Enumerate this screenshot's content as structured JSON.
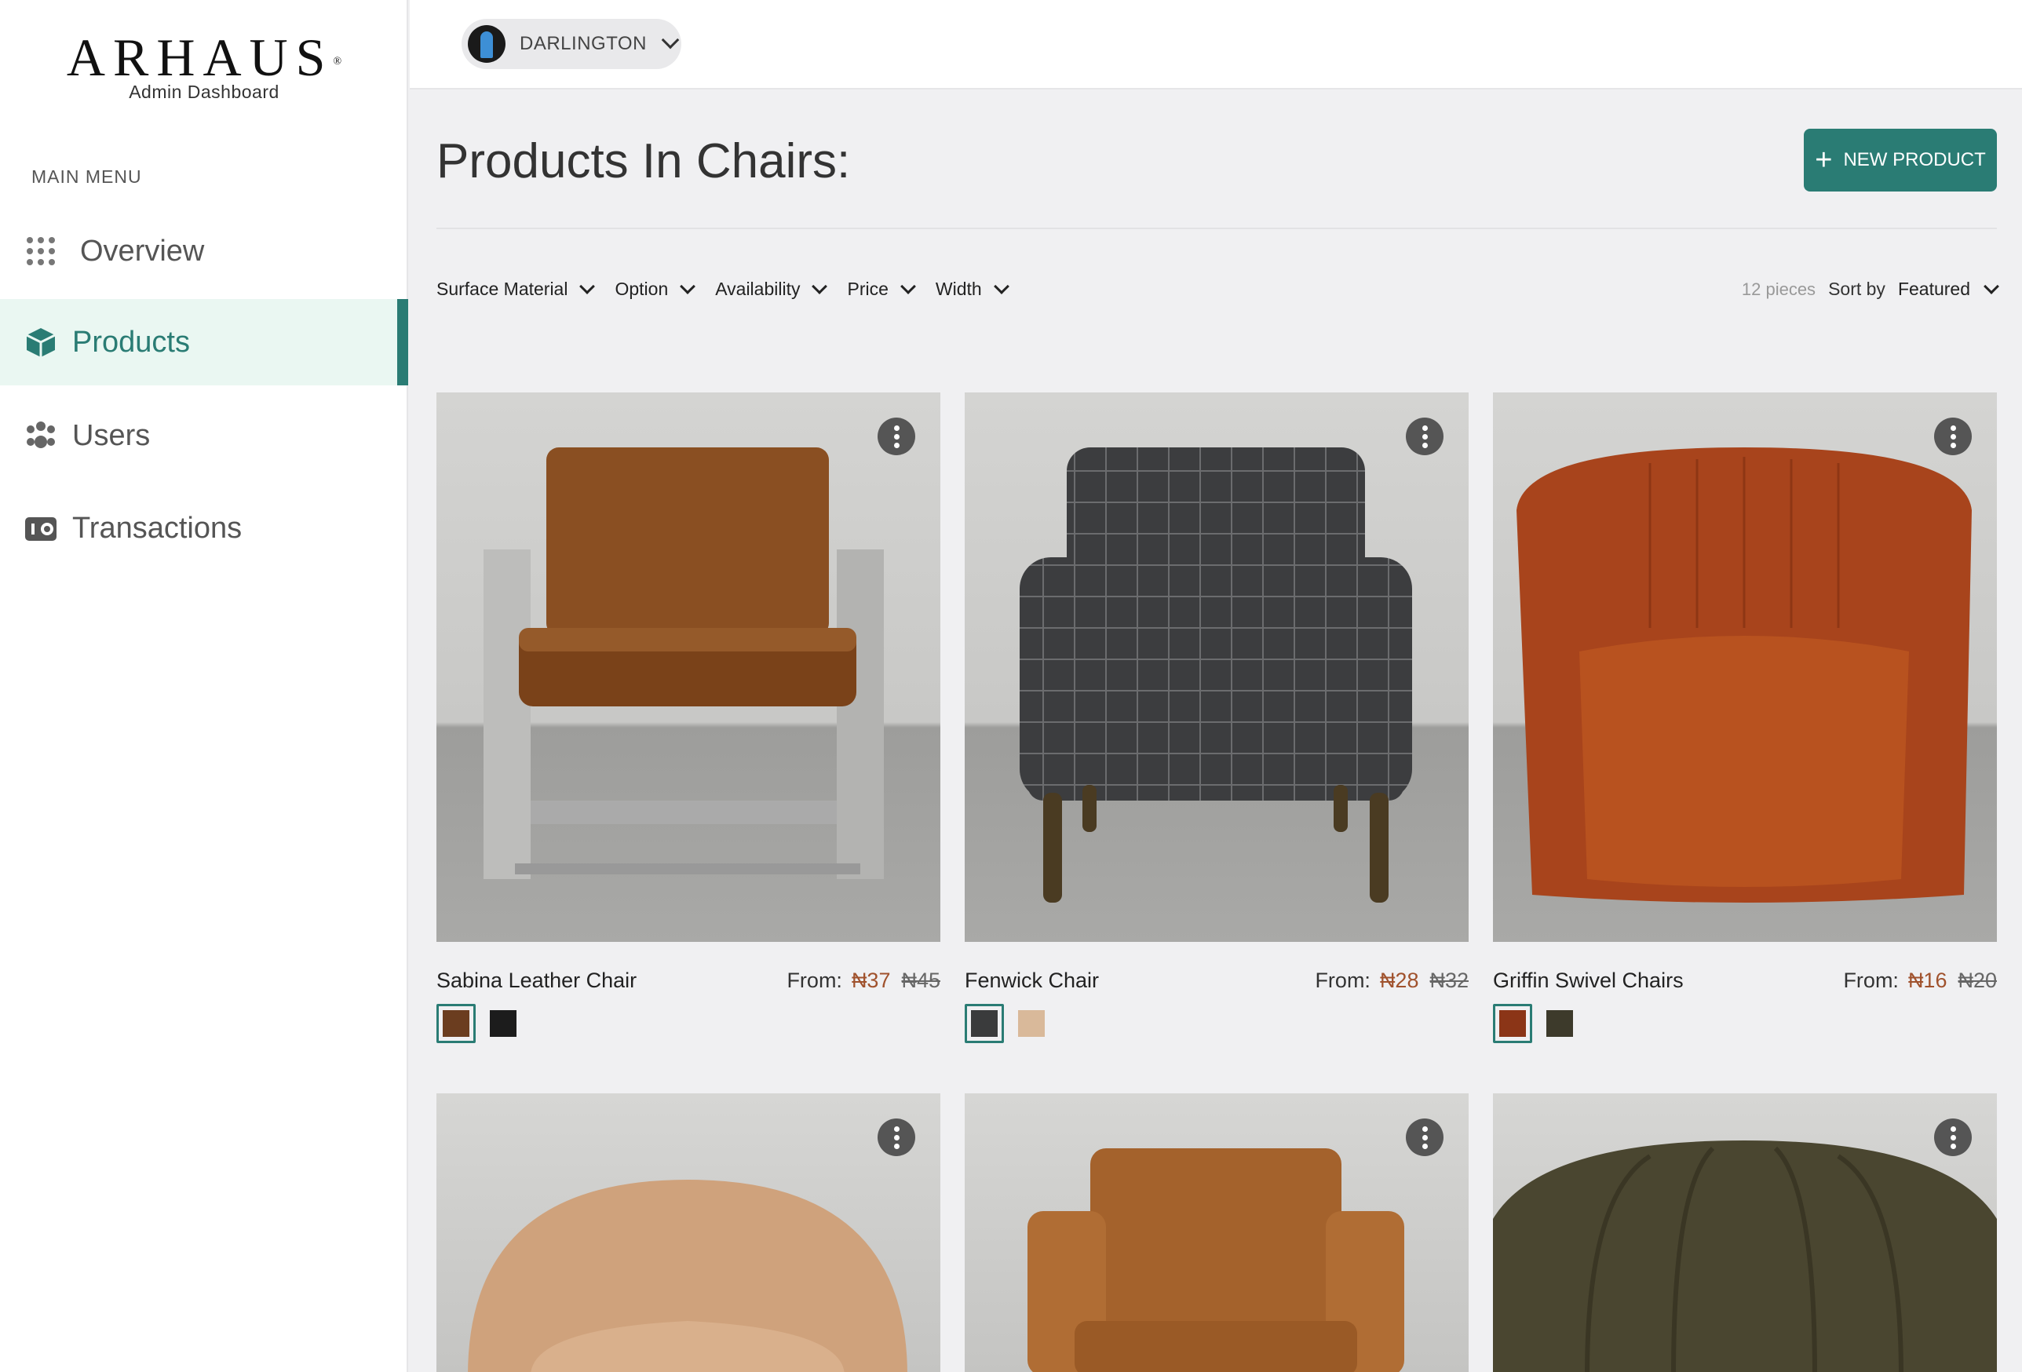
{
  "brand": {
    "name": "ARHAUS",
    "mark": "®",
    "subtitle": "Admin Dashboard"
  },
  "sidebar": {
    "menu_title": "MAIN MENU",
    "items": [
      {
        "label": "Overview",
        "icon": "grid-icon",
        "active": false
      },
      {
        "label": "Products",
        "icon": "cube-icon",
        "active": true
      },
      {
        "label": "Users",
        "icon": "users-icon",
        "active": false
      },
      {
        "label": "Transactions",
        "icon": "wallet-icon",
        "active": false
      }
    ]
  },
  "header": {
    "store_name": "DARLINGTON",
    "store_icon": "person-avatar-icon"
  },
  "main": {
    "title": "Products In Chairs:",
    "new_button": "NEW PRODUCT",
    "filters": [
      "Surface Material",
      "Option",
      "Availability",
      "Price",
      "Width"
    ],
    "count": "12 pieces",
    "sort_label": "Sort by",
    "sort_value": "Featured"
  },
  "products": [
    {
      "name": "Sabina Leather Chair",
      "from": "From:",
      "price": "₦37",
      "old_price": "₦45",
      "swatches": [
        "#6b3d1f",
        "#1c1c1c"
      ]
    },
    {
      "name": "Fenwick Chair",
      "from": "From:",
      "price": "₦28",
      "old_price": "₦32",
      "swatches": [
        "#3a3b3c",
        "#d9b99a"
      ]
    },
    {
      "name": "Griffin Swivel Chairs",
      "from": "From:",
      "price": "₦16",
      "old_price": "₦20",
      "swatches": [
        "#8b3517",
        "#3d3a2b"
      ]
    }
  ],
  "colors": {
    "accent": "#2a7c74",
    "price": "#a0522d",
    "active_bg": "#eaf7f2"
  }
}
